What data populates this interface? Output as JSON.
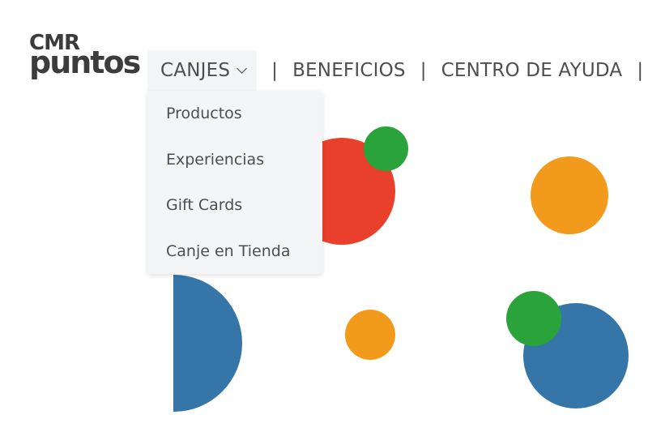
{
  "logo": {
    "line1": "CMR",
    "line2": "puntos"
  },
  "nav": {
    "items": [
      {
        "label": "CANJES"
      },
      {
        "label": "BENEFICIOS"
      },
      {
        "label": "CENTRO DE AYUDA"
      }
    ],
    "separator": "|"
  },
  "dropdown": {
    "items": [
      {
        "label": "Productos"
      },
      {
        "label": "Experiencias"
      },
      {
        "label": "Gift Cards"
      },
      {
        "label": "Canje en Tienda"
      }
    ]
  },
  "colors": {
    "red": "#e8402a",
    "green": "#2aa33a",
    "orange": "#f29a1c",
    "blue": "#3575a8"
  }
}
